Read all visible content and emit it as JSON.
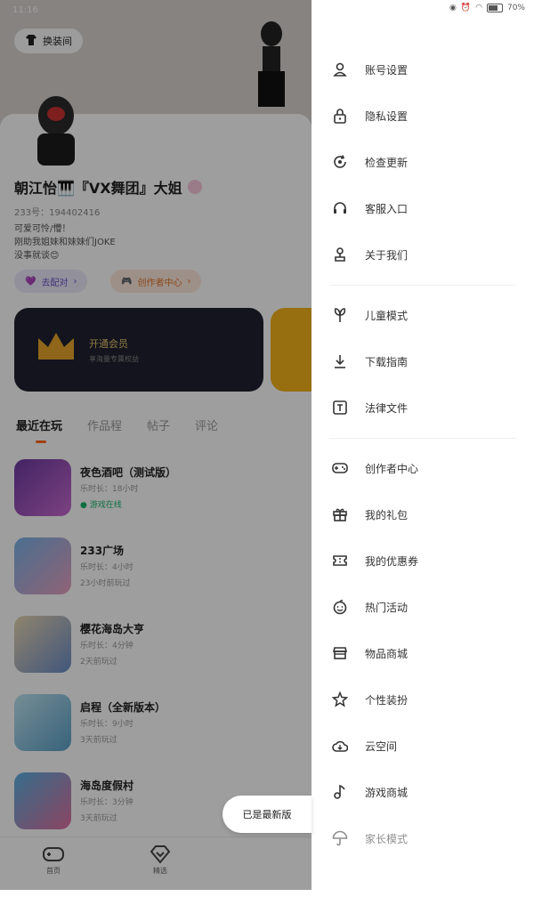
{
  "status": {
    "time": "11:16",
    "battery": "70%"
  },
  "header": {
    "skin_button": "换装间"
  },
  "profile": {
    "name": "朝江怡🎹『VX舞团』大姐",
    "id_line": "233号：194402416",
    "bio": "可爱可怜/懵！\n刚助我姐妹和妹妹们JOKE\n没事就谈😊",
    "pair_button": "去配对",
    "creator_button": "创作者中心"
  },
  "vip": {
    "title": "开通会员",
    "subtitle": "享海量专属权益"
  },
  "tabs": [
    "最近在玩",
    "作品程",
    "帖子",
    "评论"
  ],
  "games": [
    {
      "title": "夜色酒吧（测试版）",
      "line2": "乐时长：18小时",
      "line3": "游戏在线",
      "online": true
    },
    {
      "title": "233广场",
      "line2": "乐时长：4小时",
      "line3": "23小时前玩过",
      "online": false
    },
    {
      "title": "樱花海岛大亨",
      "line2": "乐时长：4分钟",
      "line3": "2天前玩过",
      "online": false
    },
    {
      "title": "启程（全新版本）",
      "line2": "乐时长：9小时",
      "line3": "3天前玩过",
      "online": false
    },
    {
      "title": "海岛度假村",
      "line2": "乐时长：3分钟",
      "line3": "3天前玩过",
      "online": false
    }
  ],
  "bottom_nav": [
    "首页",
    "精选"
  ],
  "toast": "已是最新版",
  "menu": {
    "group1": [
      {
        "label": "账号设置",
        "icon": "user-icon"
      },
      {
        "label": "隐私设置",
        "icon": "lock-icon"
      },
      {
        "label": "检查更新",
        "icon": "update-icon"
      },
      {
        "label": "客服入口",
        "icon": "headset-icon"
      },
      {
        "label": "关于我们",
        "icon": "about-icon"
      }
    ],
    "group2": [
      {
        "label": "儿童模式",
        "icon": "sprout-icon"
      },
      {
        "label": "下载指南",
        "icon": "download-icon"
      },
      {
        "label": "法律文件",
        "icon": "document-icon"
      }
    ],
    "group3": [
      {
        "label": "创作者中心",
        "icon": "gamepad-icon"
      },
      {
        "label": "我的礼包",
        "icon": "gift-icon"
      },
      {
        "label": "我的优惠券",
        "icon": "ticket-icon"
      },
      {
        "label": "热门活动",
        "icon": "smile-icon"
      },
      {
        "label": "物品商城",
        "icon": "store-icon"
      },
      {
        "label": "个性装扮",
        "icon": "star-icon"
      },
      {
        "label": "云空间",
        "icon": "cloud-icon"
      },
      {
        "label": "游戏商城",
        "icon": "music-icon"
      },
      {
        "label": "家长模式",
        "icon": "umbrella-icon"
      }
    ]
  },
  "colors": {
    "accent": "#ff6a1a",
    "vip_gold": "#e8c86c",
    "online": "#19b46a"
  }
}
